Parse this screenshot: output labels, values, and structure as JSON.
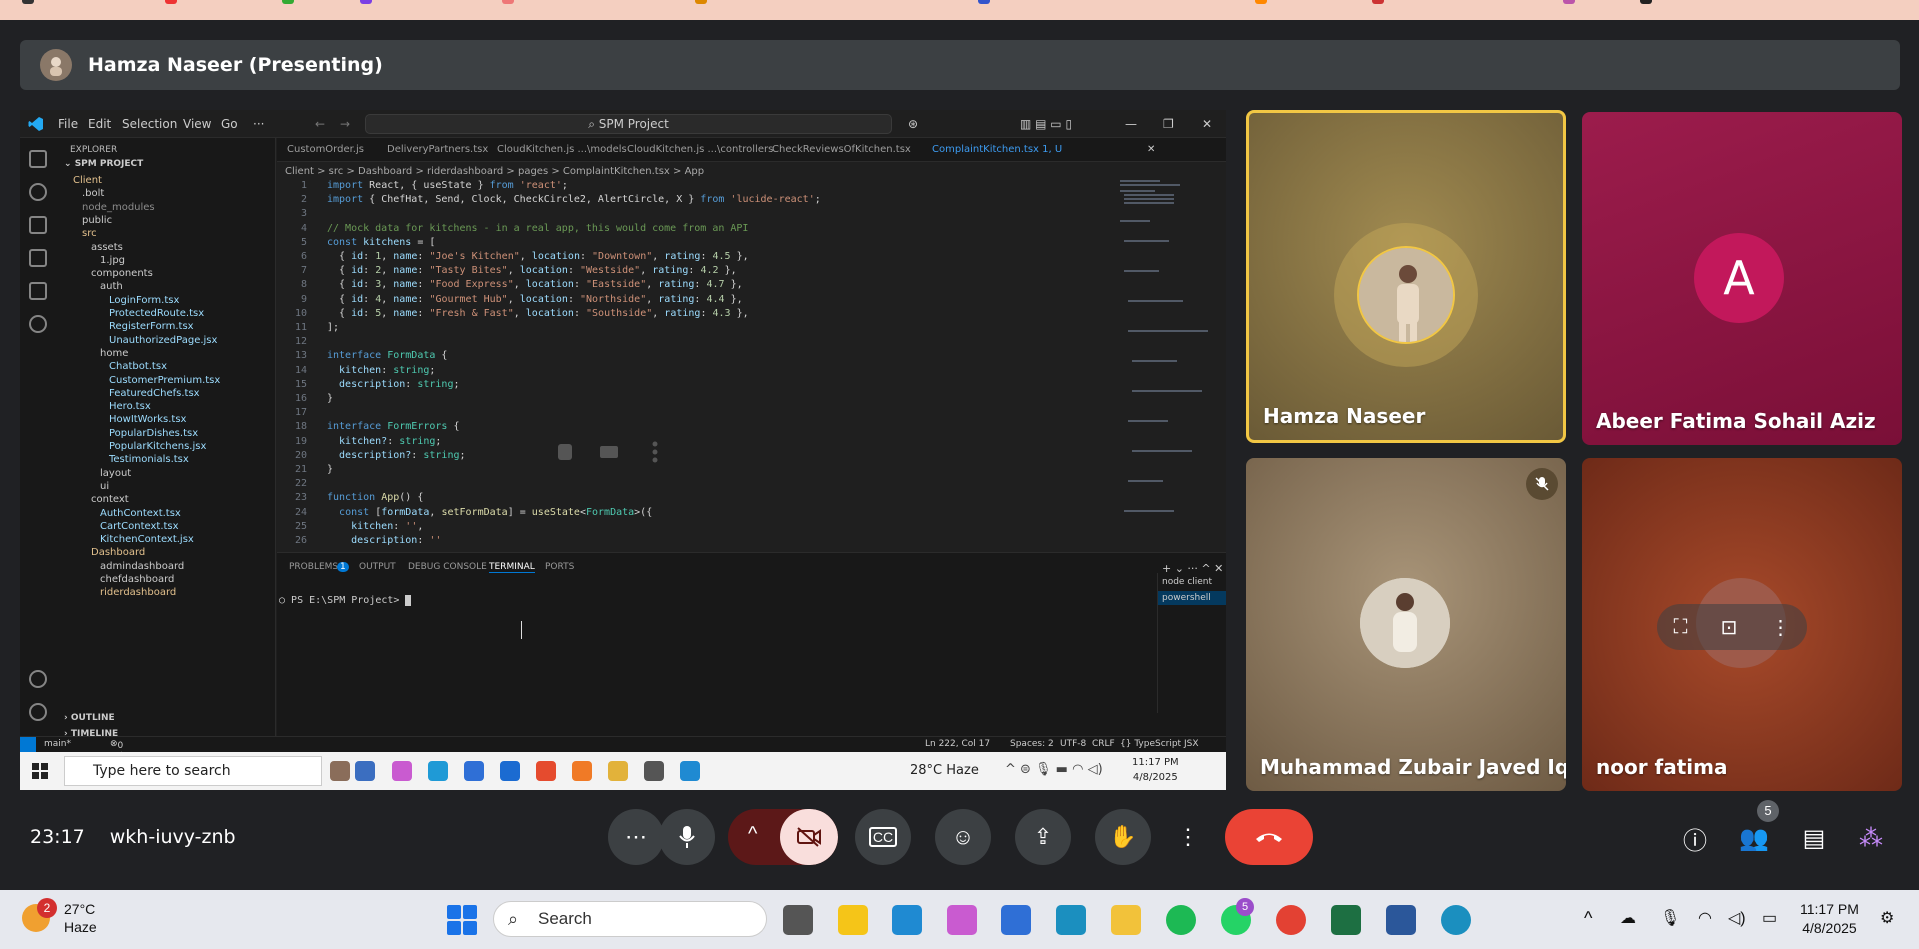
{
  "banner": {
    "presenter": "Hamza Naseer (Presenting)"
  },
  "vscode": {
    "menu": [
      "File",
      "Edit",
      "Selection",
      "View",
      "Go",
      "···"
    ],
    "search": "SPM Project",
    "explorer_title": "EXPLORER",
    "project": "SPM PROJECT",
    "tree": [
      {
        "label": "Client",
        "indent": 1,
        "color": "#e2c08d"
      },
      {
        "label": ".bolt",
        "indent": 2,
        "color": "#ccc"
      },
      {
        "label": "node_modules",
        "indent": 2,
        "color": "#8c8c8c"
      },
      {
        "label": "public",
        "indent": 2,
        "color": "#ccc"
      },
      {
        "label": "src",
        "indent": 2,
        "color": "#e2c08d"
      },
      {
        "label": "assets",
        "indent": 3,
        "color": "#ccc"
      },
      {
        "label": "1.jpg",
        "indent": 4,
        "color": "#ccc"
      },
      {
        "label": "components",
        "indent": 3,
        "color": "#ccc"
      },
      {
        "label": "auth",
        "indent": 4,
        "color": "#ccc"
      },
      {
        "label": "LoginForm.tsx",
        "indent": 5,
        "color": "#9cdcfe"
      },
      {
        "label": "ProtectedRoute.tsx",
        "indent": 5,
        "color": "#9cdcfe"
      },
      {
        "label": "RegisterForm.tsx",
        "indent": 5,
        "color": "#9cdcfe"
      },
      {
        "label": "UnauthorizedPage.jsx",
        "indent": 5,
        "color": "#9cdcfe"
      },
      {
        "label": "home",
        "indent": 4,
        "color": "#ccc"
      },
      {
        "label": "Chatbot.tsx",
        "indent": 5,
        "color": "#9cdcfe"
      },
      {
        "label": "CustomerPremium.tsx",
        "indent": 5,
        "color": "#9cdcfe"
      },
      {
        "label": "FeaturedChefs.tsx",
        "indent": 5,
        "color": "#9cdcfe"
      },
      {
        "label": "Hero.tsx",
        "indent": 5,
        "color": "#9cdcfe"
      },
      {
        "label": "HowItWorks.tsx",
        "indent": 5,
        "color": "#9cdcfe"
      },
      {
        "label": "PopularDishes.tsx",
        "indent": 5,
        "color": "#9cdcfe"
      },
      {
        "label": "PopularKitchens.jsx",
        "indent": 5,
        "color": "#9cdcfe"
      },
      {
        "label": "Testimonials.tsx",
        "indent": 5,
        "color": "#9cdcfe"
      },
      {
        "label": "layout",
        "indent": 4,
        "color": "#ccc"
      },
      {
        "label": "ui",
        "indent": 4,
        "color": "#ccc"
      },
      {
        "label": "context",
        "indent": 3,
        "color": "#ccc"
      },
      {
        "label": "AuthContext.tsx",
        "indent": 4,
        "color": "#9cdcfe"
      },
      {
        "label": "CartContext.tsx",
        "indent": 4,
        "color": "#9cdcfe"
      },
      {
        "label": "KitchenContext.jsx",
        "indent": 4,
        "color": "#9cdcfe"
      },
      {
        "label": "Dashboard",
        "indent": 3,
        "color": "#e2c08d"
      },
      {
        "label": "admindashboard",
        "indent": 4,
        "color": "#ccc"
      },
      {
        "label": "chefdashboard",
        "indent": 4,
        "color": "#ccc"
      },
      {
        "label": "riderdashboard",
        "indent": 4,
        "color": "#e2c08d"
      }
    ],
    "outline": "OUTLINE",
    "timeline": "TIMELINE",
    "tabs": [
      "CustomOrder.js",
      "DeliveryPartners.tsx",
      "CloudKitchen.js ...\\models",
      "CloudKitchen.js ...\\controllers",
      "CheckReviewsOfKitchen.tsx",
      "ComplaintKitchen.tsx 1, U"
    ],
    "breadcrumb": "Client > src > Dashboard > riderdashboard > pages > ComplaintKitchen.tsx > App",
    "panel_tabs": [
      "PROBLEMS",
      "OUTPUT",
      "DEBUG CONSOLE",
      "TERMINAL",
      "PORTS"
    ],
    "problems_count": "1",
    "terminal_line": "PS E:\\SPM Project>",
    "terminals": [
      "node client",
      "powershell"
    ],
    "status_left": "main*",
    "status_errors": "0 ⚠ 1",
    "status_right": [
      "Ln 222, Col 17",
      "Spaces: 2",
      "UTF-8",
      "CRLF",
      "{} TypeScript JSX"
    ]
  },
  "inner_taskbar": {
    "search": "Type here to search",
    "weather": "28°C Haze",
    "time": "11:17 PM",
    "date": "4/8/2025"
  },
  "participants": [
    {
      "name": "Hamza Naseer",
      "speaking": true
    },
    {
      "name": "Abeer Fatima Sohail Aziz",
      "initial": "A"
    },
    {
      "name": "Muhammad Zubair Javed Iq...",
      "muted": true
    },
    {
      "name": "noor fatima"
    }
  ],
  "meeting": {
    "time": "23:17",
    "code": "wkh-iuvy-znb",
    "people_count": "5"
  },
  "taskbar": {
    "weather_temp": "27°C",
    "weather_desc": "Haze",
    "weather_badge": "2",
    "search": "Search",
    "whatsapp_badge": "5",
    "time": "11:17 PM",
    "date": "4/8/2025"
  }
}
